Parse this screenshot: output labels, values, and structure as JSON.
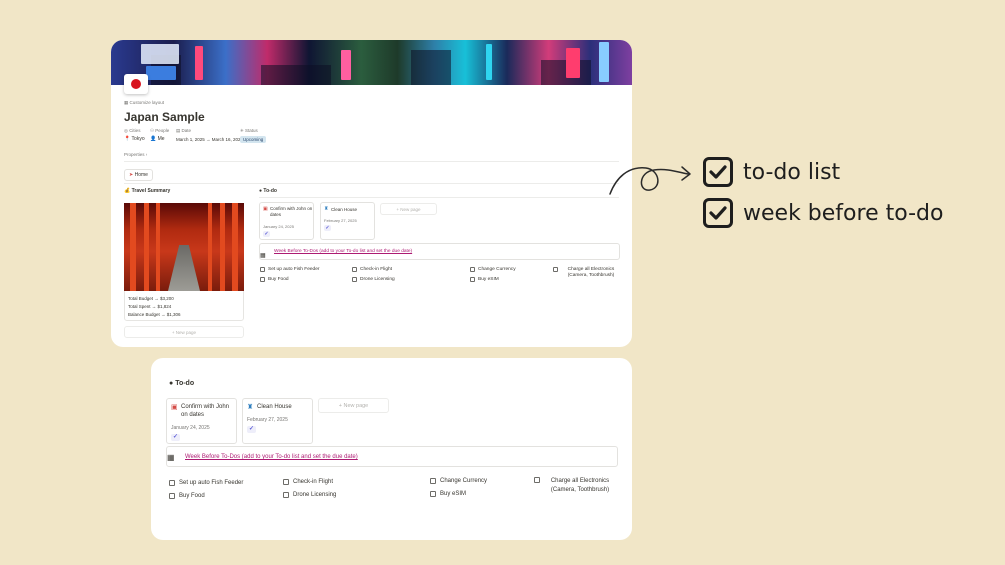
{
  "page": {
    "icon": "japan-flag-icon",
    "breadcrumb": "Customize layout",
    "title": "Japan Sample",
    "property_labels": [
      "Cities",
      "People",
      "Date",
      "Status"
    ],
    "property_values": {
      "city": "Tokyo",
      "people": "Me",
      "date": "March 1, 2025 → March 16, 2025",
      "status": "Upcoming"
    },
    "properties_toggle": "Properties",
    "home_button": "Home"
  },
  "travel_summary": {
    "heading": "Travel Summary",
    "rows": [
      "Total Budget → $3,200",
      "Total Spent → $1,824",
      "Balance Budget → $1,306"
    ],
    "new_page": "+ New page"
  },
  "todo": {
    "heading": "To-do",
    "cards": [
      {
        "title": "Confirm with John on dates",
        "date": "January 24, 2025",
        "icon": "calendar-icon",
        "done": true
      },
      {
        "title": "Clean House",
        "date": "February 27, 2025",
        "icon": "spray-bottle-icon",
        "done": true
      }
    ],
    "new_page": "+ New page",
    "week_before_link": "Week Before To-Dos (add to your To-do list and set the due date)",
    "checklist": [
      [
        "Set up auto Fish Feeder",
        "Buy Food"
      ],
      [
        "Check-in Flight",
        "Drone Licensing"
      ],
      [
        "Change Currency",
        "Buy eSIM"
      ],
      [
        "Charge all Electronics (Camera, Toothbrush)"
      ]
    ]
  },
  "callouts": {
    "items": [
      "to-do list",
      "week before to-do"
    ],
    "icon": "checkbox-checked-icon"
  },
  "colors": {
    "background": "#f1e6c7",
    "link": "#ad1a72",
    "status_tag": "#d3e5ef",
    "check_accent": "#5b5bd6"
  }
}
